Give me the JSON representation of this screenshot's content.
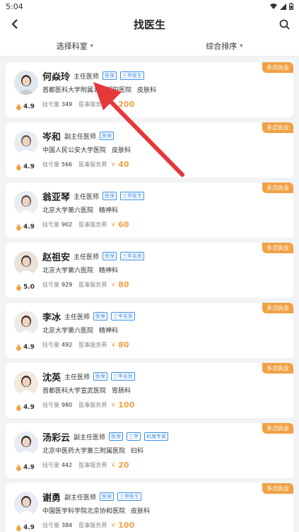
{
  "status_bar": {
    "time": "5:04"
  },
  "header": {
    "title": "找医生"
  },
  "filters": [
    {
      "label": "选择科室"
    },
    {
      "label": "综合排序"
    }
  ],
  "labels": {
    "registrations": "挂号量",
    "service_fee": "医事服务费",
    "currency": "￥"
  },
  "colors": {
    "accent": "#f0a245",
    "tag_blue": "#3a8ee6",
    "arrow": "#e5383b"
  },
  "doctors": [
    {
      "name": "何焱玲",
      "title": "主任医师",
      "tags": [
        "医保",
        "三甲医生"
      ],
      "hospital": "首都医科大学附属北京朝阳医院",
      "department": "皮肤科",
      "rating": "4.9",
      "registrations": "349",
      "fee": "200",
      "badge": "多点执业"
    },
    {
      "name": "岑和",
      "title": "副主任医师",
      "tags": [
        "医保"
      ],
      "hospital": "中国人民公安大学医院",
      "department": "皮肤科",
      "rating": "4.9",
      "registrations": "566",
      "fee": "40",
      "badge": "多点执业"
    },
    {
      "name": "翁亚琴",
      "title": "主任医师",
      "tags": [
        "医保",
        "三甲医生"
      ],
      "hospital": "北京大学第六医院",
      "department": "精神科",
      "rating": "4.9",
      "registrations": "902",
      "fee": "60",
      "badge": "多点执业"
    },
    {
      "name": "赵祖安",
      "title": "主任医师",
      "tags": [
        "医保",
        "三甲名医"
      ],
      "hospital": "北京大学第六医院",
      "department": "精神科",
      "rating": "5.0",
      "registrations": "929",
      "fee": "80",
      "badge": "多点执业"
    },
    {
      "name": "李冰",
      "title": "主任医师",
      "tags": [
        "医保",
        "三甲名医"
      ],
      "hospital": "北京大学第六医院",
      "department": "精神科",
      "rating": "4.9",
      "registrations": "492",
      "fee": "80",
      "badge": "多点执业"
    },
    {
      "name": "沈英",
      "title": "主任医师",
      "tags": [
        "医保",
        "三甲名医"
      ],
      "hospital": "首都医科大学宣武医院",
      "department": "胃肠科",
      "rating": "4.9",
      "registrations": "980",
      "fee": "100",
      "badge": "多点执业"
    },
    {
      "name": "汤彩云",
      "title": "副主任医师",
      "tags": [
        "医保",
        "三甲",
        "权威专家"
      ],
      "hospital": "北京中医药大学第三附属医院",
      "department": "妇科",
      "rating": "4.9",
      "registrations": "442",
      "fee": "20",
      "badge": "多点执业"
    },
    {
      "name": "谢勇",
      "title": "副主任医师",
      "tags": [
        "医保",
        "三甲医生"
      ],
      "hospital": "中国医学科学院北京协和医院",
      "department": "皮肤科",
      "rating": "4.9",
      "registrations": "384",
      "fee": "100",
      "badge": "多点执业"
    }
  ]
}
